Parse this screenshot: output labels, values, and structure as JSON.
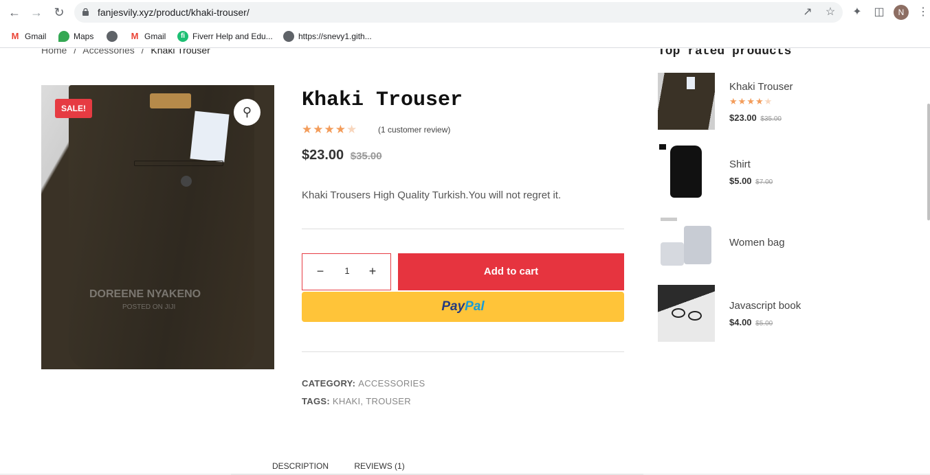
{
  "browser": {
    "url": "fanjesvily.xyz/product/khaki-trouser/",
    "avatar_letter": "N",
    "bookmarks": [
      "Gmail",
      "Maps",
      "",
      "Gmail",
      "Fiverr Help and Edu...",
      "https://snevy1.gith..."
    ]
  },
  "breadcrumb": {
    "items": [
      "Home",
      "/",
      "Accessories",
      "/",
      "Khaki Trouser"
    ]
  },
  "product": {
    "sale_badge": "SALE!",
    "image_watermark": "DOREENE NYAKENO",
    "image_watermark2": "POSTED ON JIJI",
    "title": "Khaki Trouser",
    "rating": 4,
    "rating_max": 5,
    "review_link": "(1 customer review)",
    "price": "$23.00",
    "old_price": "$35.00",
    "description": "Khaki Trousers High Quality Turkish.You will not regret it.",
    "quantity": "1",
    "add_to_cart": "Add to cart",
    "paypal_1": "Pay",
    "paypal_2": "Pal",
    "category_label": "CATEGORY:",
    "category_value": "ACCESSORIES",
    "tags_label": "TAGS:",
    "tag1": "KHAKI",
    "tag_sep": ",",
    "tag2": "TROUSER"
  },
  "tabs": [
    "DESCRIPTION",
    "REVIEWS (1)"
  ],
  "sidebar": {
    "title": "Top rated products",
    "items": [
      {
        "name": "Khaki Trouser",
        "rating": 4,
        "price": "$23.00",
        "old_price": "$35.00"
      },
      {
        "name": "Shirt",
        "price": "$5.00",
        "old_price": "$7.00"
      },
      {
        "name": "Women bag"
      },
      {
        "name": "Javascript book",
        "price": "$4.00",
        "old_price": "$5.00"
      }
    ]
  },
  "colors": {
    "accent": "#e6343f",
    "star": "#f39c5a",
    "paypal_bg": "#ffc439"
  }
}
